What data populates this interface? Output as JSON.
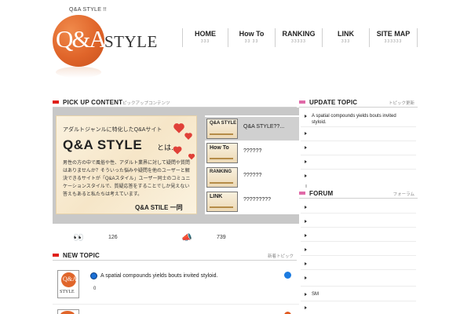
{
  "header": {
    "site_title": "Q&A STYLE  !!",
    "logo_qa": "Q&A",
    "logo_style": "STYLE"
  },
  "nav": [
    {
      "label": "HOME",
      "sub": "333"
    },
    {
      "label": "How To",
      "sub": "33 33"
    },
    {
      "label": "RANKING",
      "sub": "33333"
    },
    {
      "label": "LINK",
      "sub": "333"
    },
    {
      "label": "SITE MAP",
      "sub": "333333"
    }
  ],
  "pickup": {
    "title": "PICK UP CONTENT",
    "subtitle": "ピックアップコンテンツ",
    "banner": {
      "catch": "アダルトジャンルに特化したQ&Aサイト",
      "title": "Q&A STYLE",
      "title_suffix": "とは…",
      "body": "男性の方の中で風俗や性、アダルト業界に対して疑問や質問はありませんか？そういった悩みや疑問を他のユーザーと解決できるサイトが「Q&Aスタイル」ユーザー同士のコミュニケーションスタイルで、質疑応答をすることでしか見えない答えもあると私たちは考えています。",
      "signature": "Q&A STILE 一同"
    },
    "items": [
      {
        "thumb": "Q&A STYLE",
        "label": "Q&A STYLE??..."
      },
      {
        "thumb": "How To",
        "label": "??????"
      },
      {
        "thumb": "RANKING",
        "label": "??????"
      },
      {
        "thumb": "LINK",
        "label": "?????????"
      }
    ],
    "stats": [
      {
        "icon": "eyes-icon",
        "glyph": "👀",
        "value": "126"
      },
      {
        "icon": "megaphone-icon",
        "glyph": "📣",
        "value": "739"
      }
    ]
  },
  "new_topic": {
    "title": "NEW TOPIC",
    "subtitle": "新着トピック",
    "items": [
      {
        "avatar_qa": "Q&A",
        "avatar_style": "STYLE",
        "title": "A spatial compounds yields bouts invited styloid.",
        "count": "0"
      }
    ]
  },
  "update_topic": {
    "title": "UPDATE TOPIC",
    "subtitle": "トピック更新",
    "first": "A spatial compounds yields bouts invited styloid."
  },
  "forum": {
    "title": "FORUM",
    "subtitle": "フォーラム",
    "sm_label": "SM"
  },
  "colors": {
    "accent_red": "#e0201a",
    "accent_pink": "#e06aa8",
    "logo_orange": "#e0652a",
    "pickup_bg": "#c8c8c8"
  }
}
